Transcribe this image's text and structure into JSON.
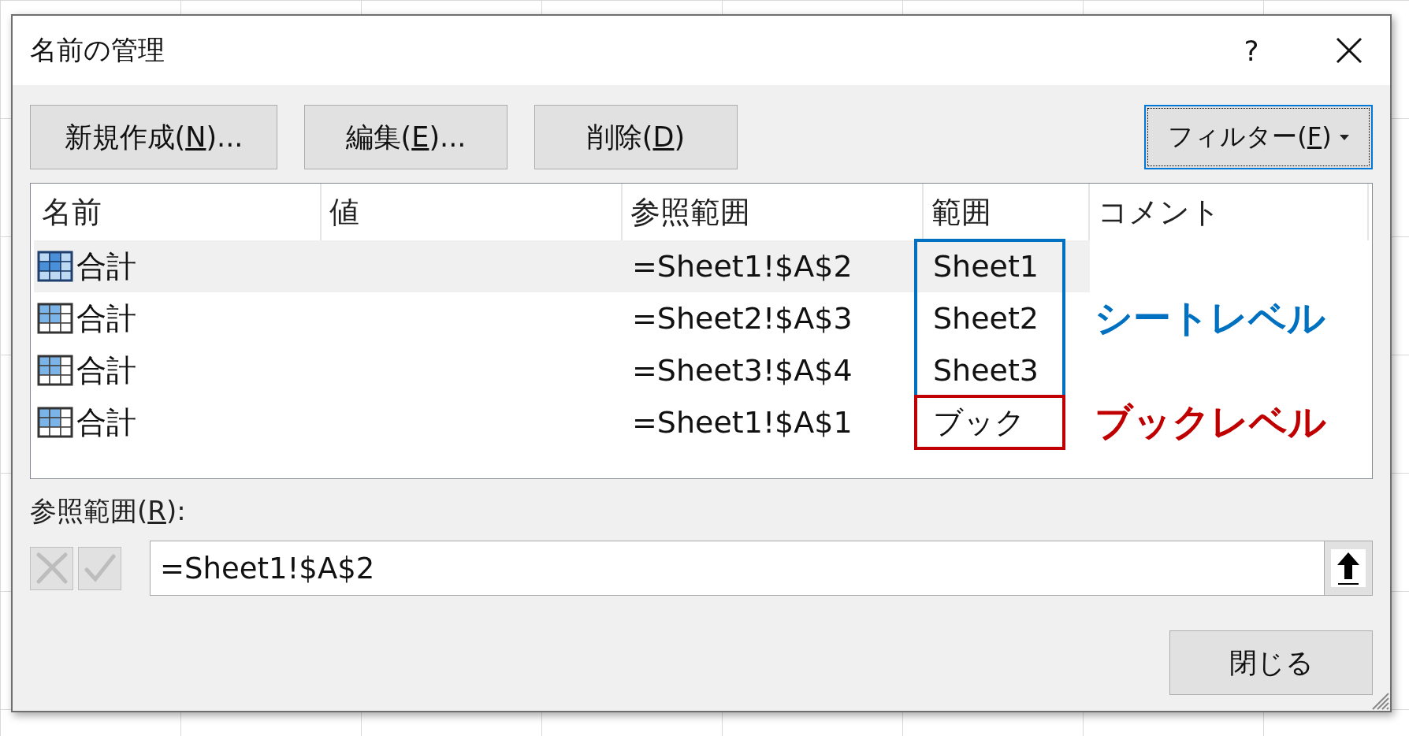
{
  "window": {
    "title": "名前の管理",
    "help": "?"
  },
  "toolbar": {
    "buttons": [
      {
        "before": "新規作成(",
        "key": "N",
        "after": ")..."
      },
      {
        "before": "編集(",
        "key": "E",
        "after": ")..."
      },
      {
        "before": "削除(",
        "key": "D",
        "after": ")"
      }
    ],
    "filter": {
      "before": "フィルター(",
      "key": "F",
      "after": ")",
      "focused": true
    }
  },
  "table": {
    "columns": [
      "名前",
      "値",
      "参照範囲",
      "範囲",
      "コメント"
    ],
    "groups": [
      {
        "label": "シートレベル",
        "color": "#0070c0",
        "rows": [
          {
            "name": "合計",
            "refers_to": "=Sheet1!$A$2",
            "scope": "Sheet1",
            "selected": true
          },
          {
            "name": "合計",
            "refers_to": "=Sheet2!$A$3",
            "scope": "Sheet2",
            "selected": false
          },
          {
            "name": "合計",
            "refers_to": "=Sheet3!$A$4",
            "scope": "Sheet3",
            "selected": false
          }
        ]
      },
      {
        "label": "ブックレベル",
        "color": "#c00000",
        "rows": [
          {
            "name": "合計",
            "refers_to": "=Sheet1!$A$1",
            "scope": "ブック",
            "selected": false
          }
        ]
      }
    ]
  },
  "reference": {
    "label": {
      "before": "参照範囲(",
      "key": "R",
      "after": "):"
    },
    "value": "=Sheet1!$A$2",
    "edit_buttons_disabled": true
  },
  "close_button": "閉じる"
}
